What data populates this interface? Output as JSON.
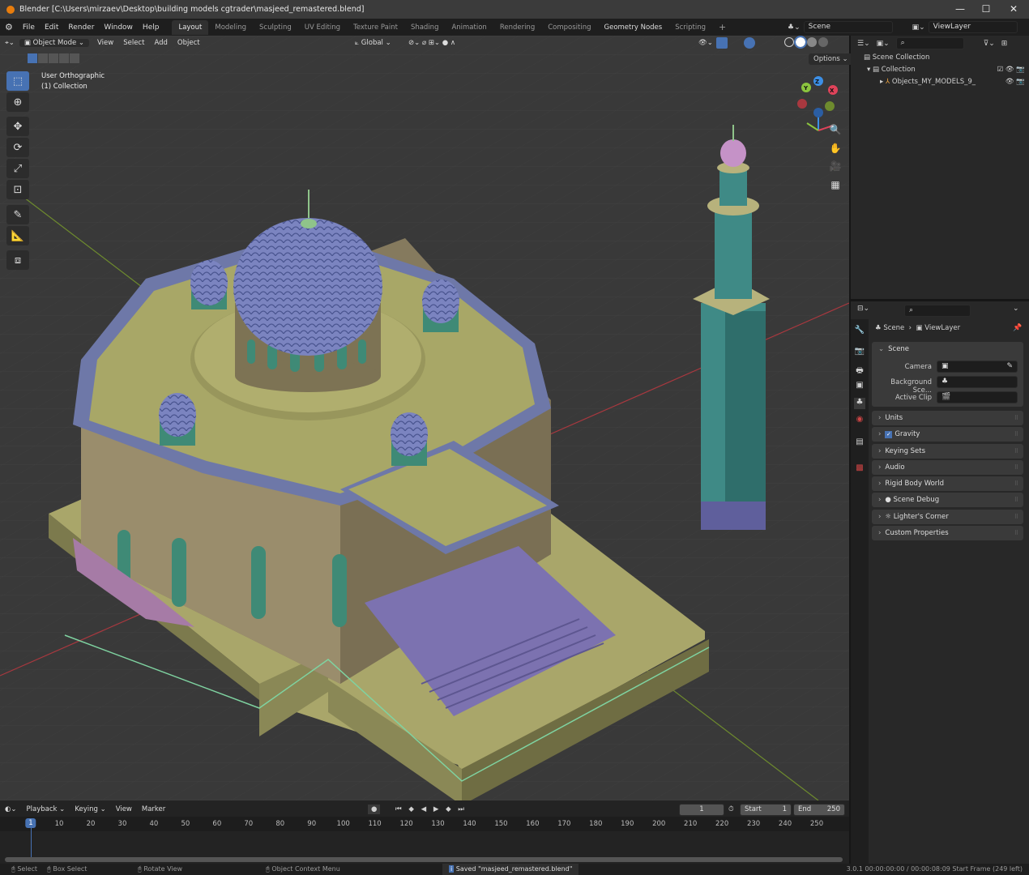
{
  "window": {
    "title": "Blender [C:\\Users\\mirzaev\\Desktop\\building models cgtrader\\masjeed_remastered.blend]",
    "minimize": "—",
    "maximize": "☐",
    "close": "✕"
  },
  "menu": [
    "File",
    "Edit",
    "Render",
    "Window",
    "Help"
  ],
  "workspaces": [
    {
      "label": "Layout",
      "active": true
    },
    {
      "label": "Modeling"
    },
    {
      "label": "Sculpting"
    },
    {
      "label": "UV Editing"
    },
    {
      "label": "Texture Paint"
    },
    {
      "label": "Shading"
    },
    {
      "label": "Animation"
    },
    {
      "label": "Rendering"
    },
    {
      "label": "Compositing"
    },
    {
      "label": "Geometry Nodes"
    },
    {
      "label": "Scripting"
    },
    {
      "label": "+"
    }
  ],
  "scene_selector": "Scene",
  "viewlayer_selector": "ViewLayer",
  "viewport_header": {
    "mode": "Object Mode",
    "menus": [
      "View",
      "Select",
      "Add",
      "Object"
    ],
    "transform_orientation": "Global",
    "options": "Options"
  },
  "viewport_overlay": {
    "view_name": "User Orthographic",
    "collection": "(1) Collection"
  },
  "gizmo": {
    "axes": [
      "X",
      "Y",
      "Z"
    ],
    "colors": {
      "x": "#e0435a",
      "y": "#8bc43e",
      "z": "#3c8fe6"
    }
  },
  "outliner": {
    "items": [
      {
        "label": "Scene Collection"
      },
      {
        "label": "Collection"
      },
      {
        "label": "Objects_MY_MODELS_9_"
      }
    ]
  },
  "properties": {
    "breadcrumb": [
      "Scene",
      "ViewLayer"
    ],
    "scene_panel": {
      "title": "Scene",
      "fields": [
        {
          "label": "Camera",
          "value": ""
        },
        {
          "label": "Background Sce...",
          "value": ""
        },
        {
          "label": "Active Clip",
          "value": ""
        }
      ]
    },
    "panels": [
      {
        "label": "Units"
      },
      {
        "label": "Gravity",
        "checked": true
      },
      {
        "label": "Keying Sets"
      },
      {
        "label": "Audio"
      },
      {
        "label": "Rigid Body World"
      },
      {
        "label": "Scene Debug"
      },
      {
        "label": "Lighter's Corner"
      },
      {
        "label": "Custom Properties"
      }
    ]
  },
  "timeline": {
    "menus": [
      "Playback",
      "Keying",
      "View",
      "Marker"
    ],
    "current_frame": "1",
    "start_label": "Start",
    "start": "1",
    "end_label": "End",
    "end": "250",
    "ticks": [
      "1",
      "10",
      "20",
      "30",
      "40",
      "50",
      "60",
      "70",
      "80",
      "90",
      "100",
      "110",
      "120",
      "130",
      "140",
      "150",
      "160",
      "170",
      "180",
      "190",
      "200",
      "210",
      "220",
      "230",
      "240",
      "250"
    ]
  },
  "statusbar": {
    "hints": [
      "Select",
      "Box Select",
      "Rotate View",
      "Object Context Menu"
    ],
    "message": "Saved \"masjeed_remastered.blend\"",
    "info": "3.0.1  00:00:00:00 / 00:00:08:09  Start Frame (249 left)"
  }
}
